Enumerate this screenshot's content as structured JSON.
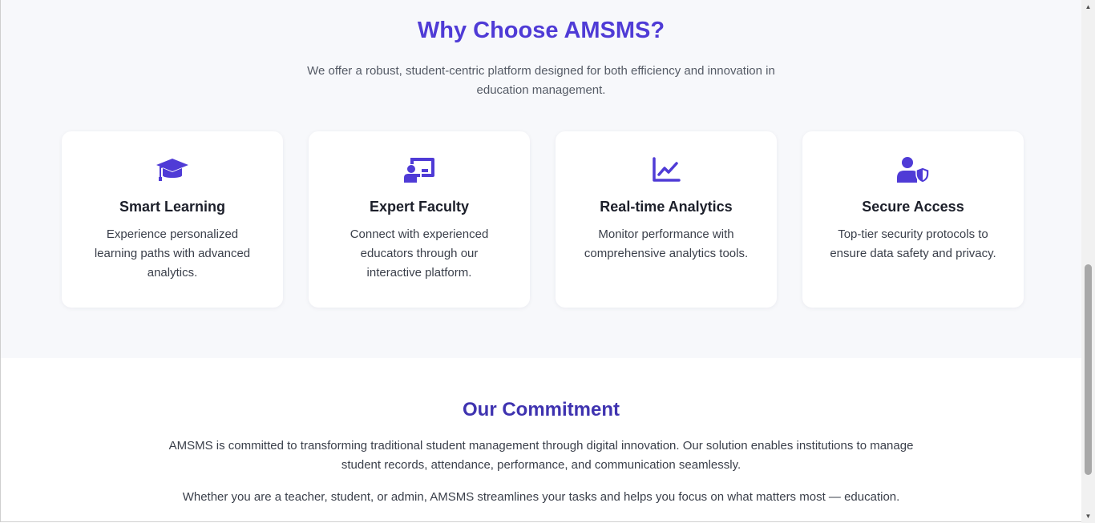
{
  "why_section": {
    "title": "Why Choose AMSMS?",
    "subtitle": "We offer a robust, student-centric platform designed for both efficiency and innovation in education management.",
    "cards": [
      {
        "icon": "graduation-cap-icon",
        "title": "Smart Learning",
        "description": "Experience personalized learning paths with advanced analytics."
      },
      {
        "icon": "chalkboard-teacher-icon",
        "title": "Expert Faculty",
        "description": "Connect with experienced educators through our interactive platform."
      },
      {
        "icon": "chart-line-icon",
        "title": "Real-time Analytics",
        "description": "Monitor performance with comprehensive analytics tools."
      },
      {
        "icon": "user-shield-icon",
        "title": "Secure Access",
        "description": "Top-tier security protocols to ensure data safety and privacy."
      }
    ]
  },
  "commitment_section": {
    "title": "Our Commitment",
    "paragraph1": "AMSMS is committed to transforming traditional student management through digital innovation. Our solution enables institutions to manage student records, attendance, performance, and communication seamlessly.",
    "paragraph2": "Whether you are a teacher, student, or admin, AMSMS streamlines your tasks and helps you focus on what matters most — education."
  },
  "colors": {
    "accent": "#4f3bd6",
    "commitment_title": "#3f33b0",
    "section_bg": "#f7f8fb"
  }
}
